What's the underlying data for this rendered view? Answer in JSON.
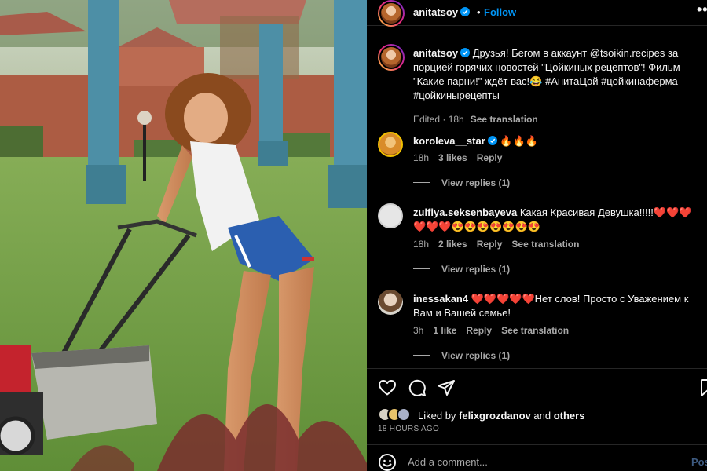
{
  "post": {
    "author": "anitatsoy",
    "separator": "•",
    "follow_label": "Follow",
    "more_label": "•••"
  },
  "caption": {
    "username": "anitatsoy",
    "text": " Друзья! Бегом в аккаунт @tsoikin.recipes за порцией горячих новостей \"Цойкиных рецептов\"! Фильм \"Какие парни!\" ждёт вас!😂 #АнитаЦой  #цойкинаферма #цойкинырецепты",
    "edited": "Edited · 18h",
    "translate": "See translation"
  },
  "comments": [
    {
      "username": "koroleva__star",
      "text": " 🔥🔥🔥",
      "time": "18h",
      "likes": "3 likes",
      "reply": "Reply",
      "translate": "",
      "view_replies": "View replies (1)"
    },
    {
      "username": "zulfiya.seksenbayeva",
      "text": " Какая Красивая Девушка!!!!!❤️❤️❤️❤️❤️❤️😍😍😍😍😍😍😍",
      "time": "18h",
      "likes": "2 likes",
      "reply": "Reply",
      "translate": "See translation",
      "view_replies": "View replies (1)"
    },
    {
      "username": "inessakan4",
      "text": " ❤️❤️❤️❤️❤️Нет слов! Просто с Уважением к Вам и Вашей семье!",
      "time": "3h",
      "likes": "1 like",
      "reply": "Reply",
      "translate": "See translation",
      "view_replies": "View replies (1)"
    }
  ],
  "likes": {
    "prefix": "Liked by ",
    "user": "felixgrozdanov",
    "middle": " and ",
    "others": "others"
  },
  "timestamp": "18 HOURS AGO",
  "add_comment": {
    "placeholder": "Add a comment...",
    "post_label": "Post"
  },
  "icons": {
    "like": "heart-icon",
    "comment": "comment-icon",
    "share": "share-icon",
    "save": "bookmark-icon",
    "emoji": "emoji-icon",
    "verified": "verified-badge-icon"
  },
  "colors": {
    "accent": "#0095f6",
    "background": "#000000",
    "secondary_text": "#a8a8a8",
    "divider": "#262626"
  }
}
